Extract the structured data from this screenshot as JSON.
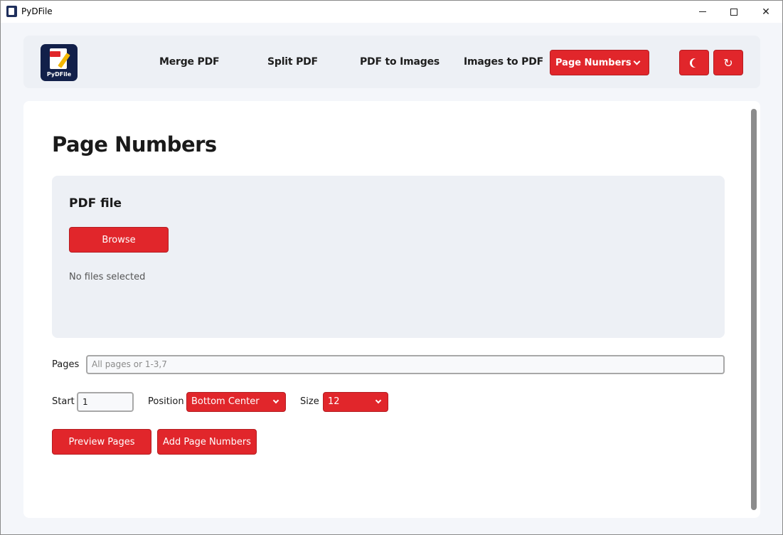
{
  "window": {
    "title": "PyDFile",
    "minimize": "",
    "maximize": "",
    "close": "✕"
  },
  "header": {
    "logo_text": "PyDFile",
    "nav": {
      "merge": "Merge PDF",
      "split": "Split PDF",
      "pdf_to_images": "PDF to Images",
      "images_to_pdf": "Images to PDF",
      "selected": "Page Numbers"
    },
    "icons": {
      "theme": "moon-icon",
      "reload": "reload-icon",
      "reload_glyph": "↻"
    }
  },
  "main": {
    "title": "Page Numbers",
    "file_panel": {
      "title": "PDF file",
      "browse_label": "Browse",
      "status": "No files selected"
    },
    "form": {
      "pages_label": "Pages",
      "pages_placeholder": "All pages or 1-3,7",
      "start_label": "Start",
      "start_value": "1",
      "position_label": "Position",
      "position_value": "Bottom Center",
      "size_label": "Size",
      "size_value": "12"
    },
    "actions": {
      "preview_label": "Preview Pages",
      "add_label": "Add Page Numbers"
    }
  },
  "colors": {
    "accent": "#e1262b",
    "panel_bg": "#edf0f5",
    "page_bg": "#f4f6fa"
  }
}
